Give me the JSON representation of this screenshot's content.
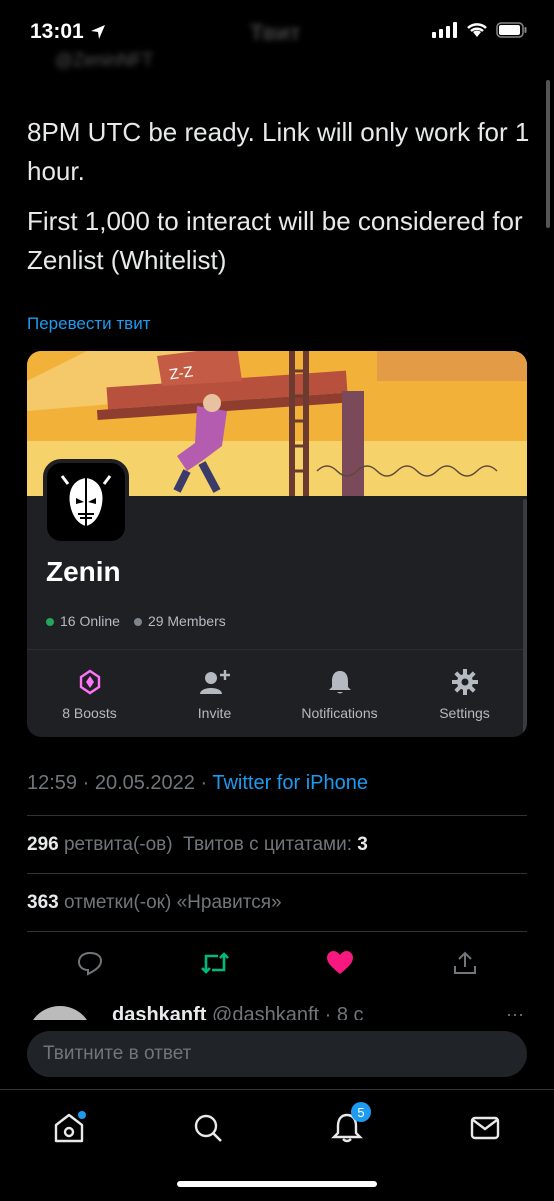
{
  "status_bar": {
    "time": "13:01"
  },
  "header": {
    "title": "Твит",
    "handle": "@ZeninNFT"
  },
  "tweet": {
    "line1": "8PM UTC be ready. Link will only work for 1 hour.",
    "line2": "First 1,000 to interact will be considered for Zenlist (Whitelist)",
    "translate": "Перевести твит"
  },
  "card": {
    "server_name": "Zenin",
    "online": "16 Online",
    "members": "29 Members",
    "actions": [
      {
        "label": "8 Boosts",
        "icon": "boost-icon"
      },
      {
        "label": "Invite",
        "icon": "add-user-icon"
      },
      {
        "label": "Notifications",
        "icon": "bell-icon"
      },
      {
        "label": "Settings",
        "icon": "gear-icon"
      }
    ],
    "colors": {
      "online": "#23a55a",
      "members": "#80848e",
      "boost": "#ff73fa"
    }
  },
  "meta": {
    "timestamp": "12:59 · 20.05.2022 ·",
    "source": "Twitter for iPhone"
  },
  "stats": {
    "retweets_count": "296",
    "retweets_label": "ретвита(-ов)",
    "quotes_label": "Твитов с цитатами:",
    "quotes_count": "3",
    "likes_count": "363",
    "likes_label": "отметки(-ок) «Нравится»"
  },
  "reply_preview": {
    "name": "dashkanft",
    "handle": "@dashkanft · 8 с"
  },
  "reply_input": {
    "placeholder": "Твитните в ответ"
  },
  "tabbar": {
    "notifications_badge": "5"
  },
  "colors": {
    "accent": "#1d9bf0",
    "retweet": "#00ba7c",
    "like": "#f91880"
  }
}
